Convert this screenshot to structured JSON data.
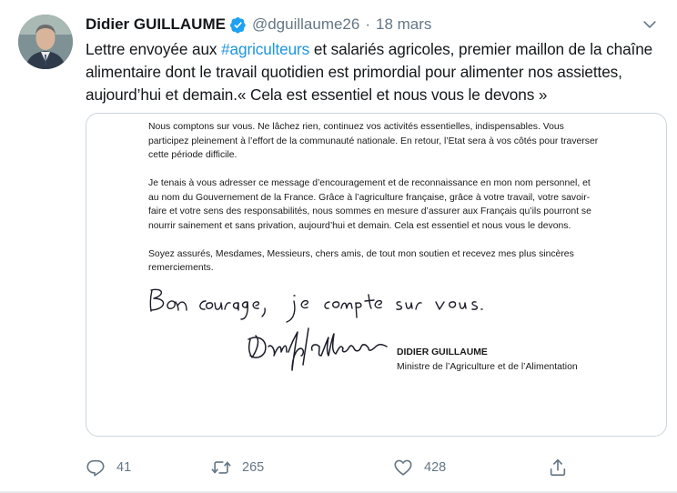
{
  "author": {
    "display_name": "Didier GUILLAUME",
    "handle": "@dguillaume26",
    "separator": "·",
    "date": "18 mars",
    "verified": true,
    "avatar": "profile-photo"
  },
  "tweet": {
    "text_before": "Lettre envoyée aux ",
    "hashtag": "#agriculteurs",
    "text_after": " et salariés agricoles, premier maillon de la chaîne alimentaire dont le travail quotidien est primordial pour alimenter nos assiettes, aujourd’hui et demain.« Cela est essentiel et nous vous le devons »"
  },
  "media": {
    "paragraphs": [
      "Nous comptons sur vous. Ne lâchez rien, continuez vos activités essentielles, indispensables. Vous participez pleinement à l’effort de la communauté nationale. En retour, l’Etat sera à vos côtés pour traverser cette période difficile.",
      "Je tenais à vous adresser ce message d’encouragement et de reconnaissance en mon nom personnel, et au nom du Gouvernement de la France. Grâce à l’agriculture française, grâce à votre travail, votre savoir-faire et votre sens des responsabilités, nous sommes en mesure d’assurer aux Français qu’ils pourront se nourrir sainement et sans privation, aujourd’hui et demain. Cela est essentiel et nous vous le devons.",
      "Soyez assurés, Mesdames, Messieurs, chers amis, de tout mon soutien et recevez mes plus sincères remerciements."
    ],
    "handwritten_note": "Bon courage, je compte sur vous.",
    "signature_name": "DIDIER GUILLAUME",
    "signature_title": "Ministre de l’Agriculture et de l’Alimentation"
  },
  "actions": {
    "reply_count": "41",
    "retweet_count": "265",
    "like_count": "428"
  },
  "icons": {
    "reply": "reply-icon",
    "retweet": "retweet-icon",
    "like": "heart-icon",
    "share": "share-icon",
    "more": "chevron-down-icon",
    "verified": "verified-badge-icon"
  },
  "colors": {
    "link": "#1b95e0",
    "muted": "#657786",
    "verified": "#1da1f2",
    "border": "#ccd6dd"
  }
}
